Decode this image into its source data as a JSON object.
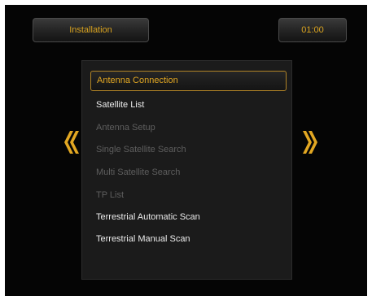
{
  "header": {
    "title": "Installation",
    "clock": "01:00"
  },
  "menu": {
    "items": [
      {
        "label": "Antenna Connection",
        "state": "selected"
      },
      {
        "label": "Satellite List",
        "state": "enabled"
      },
      {
        "label": "Antenna Setup",
        "state": "disabled"
      },
      {
        "label": "Single Satellite Search",
        "state": "disabled"
      },
      {
        "label": "Multi Satellite Search",
        "state": "disabled"
      },
      {
        "label": "TP List",
        "state": "disabled"
      },
      {
        "label": "Terrestrial Automatic Scan",
        "state": "enabled"
      },
      {
        "label": "Terrestrial Manual Scan",
        "state": "enabled"
      }
    ]
  },
  "nav": {
    "left_icon": "double-chevron-left-icon",
    "right_icon": "double-chevron-right-icon"
  },
  "colors": {
    "accent": "#e2a722",
    "background": "#050505",
    "panel": "#1b1b1b",
    "text": "#ececec",
    "disabled_text": "#5e5e5e"
  }
}
